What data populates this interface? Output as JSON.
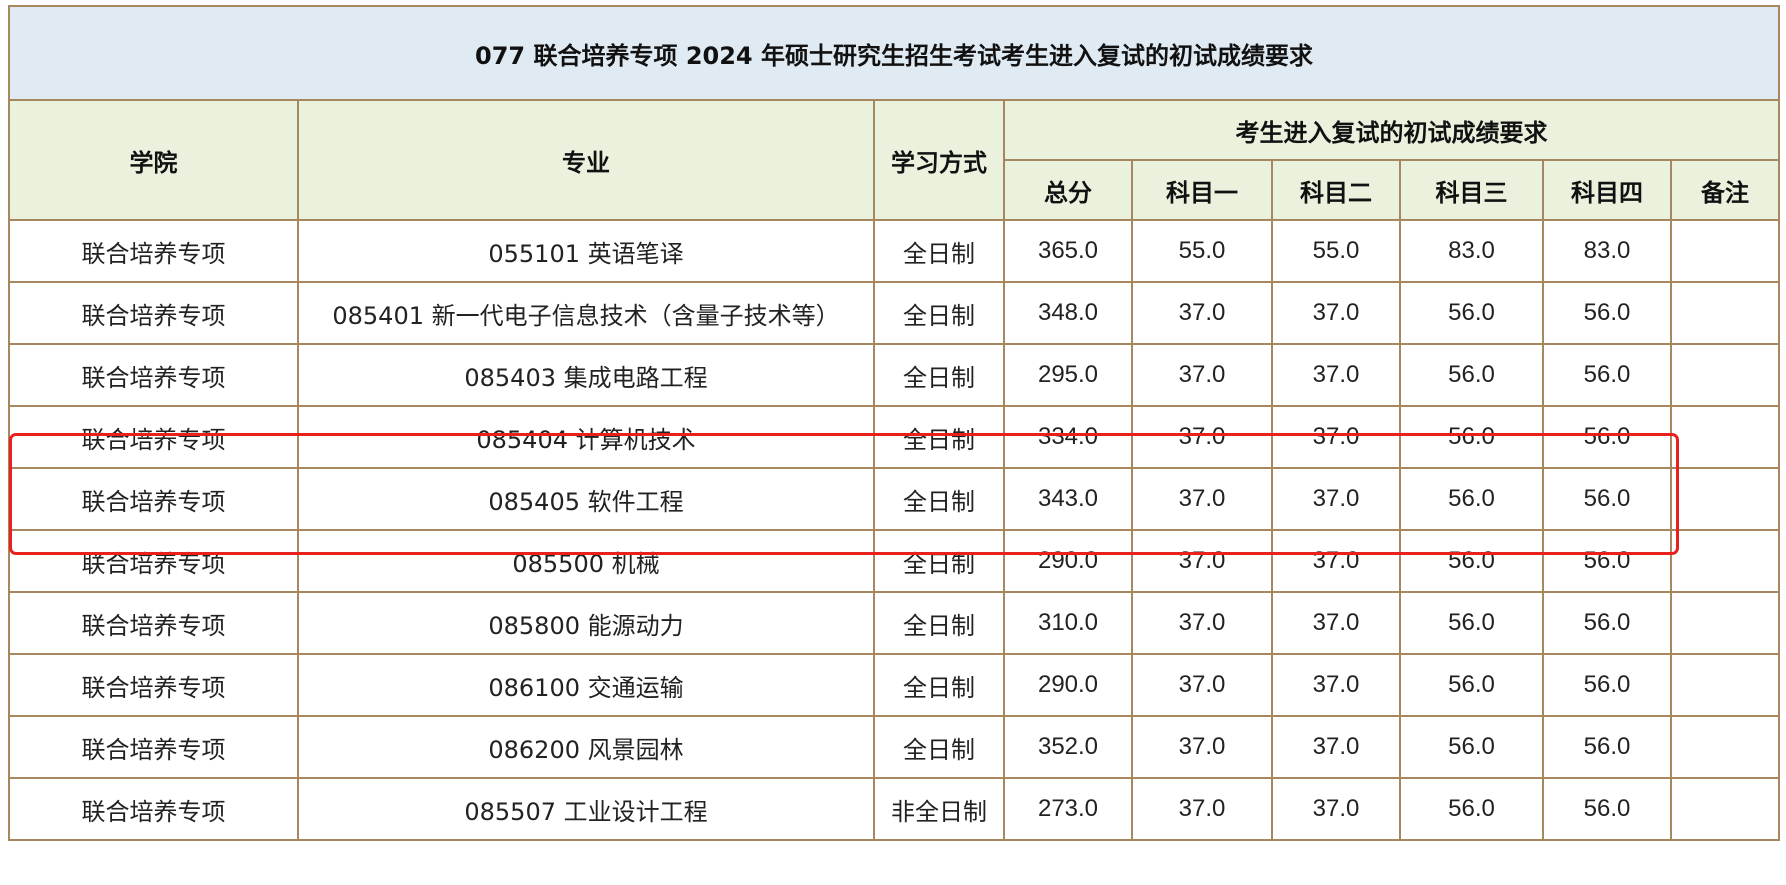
{
  "title": "077 联合培养专项 2024 年硕士研究生招生考试考生进入复试的初试成绩要求",
  "headers": {
    "college": "学院",
    "major": "专业",
    "study_mode": "学习方式",
    "requirements_group": "考生进入复试的初试成绩要求",
    "total": "总分",
    "subject1": "科目一",
    "subject2": "科目二",
    "subject3": "科目三",
    "subject4": "科目四",
    "remark": "备注"
  },
  "rows": [
    {
      "college": "联合培养专项",
      "major": "055101 英语笔译",
      "mode": "全日制",
      "total": "365.0",
      "s1": "55.0",
      "s2": "55.0",
      "s3": "83.0",
      "s4": "83.0",
      "remark": ""
    },
    {
      "college": "联合培养专项",
      "major": "085401 新一代电子信息技术（含量子技术等）",
      "mode": "全日制",
      "total": "348.0",
      "s1": "37.0",
      "s2": "37.0",
      "s3": "56.0",
      "s4": "56.0",
      "remark": ""
    },
    {
      "college": "联合培养专项",
      "major": "085403 集成电路工程",
      "mode": "全日制",
      "total": "295.0",
      "s1": "37.0",
      "s2": "37.0",
      "s3": "56.0",
      "s4": "56.0",
      "remark": ""
    },
    {
      "college": "联合培养专项",
      "major": "085404 计算机技术",
      "mode": "全日制",
      "total": "334.0",
      "s1": "37.0",
      "s2": "37.0",
      "s3": "56.0",
      "s4": "56.0",
      "remark": ""
    },
    {
      "college": "联合培养专项",
      "major": "085405 软件工程",
      "mode": "全日制",
      "total": "343.0",
      "s1": "37.0",
      "s2": "37.0",
      "s3": "56.0",
      "s4": "56.0",
      "remark": ""
    },
    {
      "college": "联合培养专项",
      "major": "085500 机械",
      "mode": "全日制",
      "total": "290.0",
      "s1": "37.0",
      "s2": "37.0",
      "s3": "56.0",
      "s4": "56.0",
      "remark": ""
    },
    {
      "college": "联合培养专项",
      "major": "085800 能源动力",
      "mode": "全日制",
      "total": "310.0",
      "s1": "37.0",
      "s2": "37.0",
      "s3": "56.0",
      "s4": "56.0",
      "remark": ""
    },
    {
      "college": "联合培养专项",
      "major": "086100 交通运输",
      "mode": "全日制",
      "total": "290.0",
      "s1": "37.0",
      "s2": "37.0",
      "s3": "56.0",
      "s4": "56.0",
      "remark": ""
    },
    {
      "college": "联合培养专项",
      "major": "086200 风景园林",
      "mode": "全日制",
      "total": "352.0",
      "s1": "37.0",
      "s2": "37.0",
      "s3": "56.0",
      "s4": "56.0",
      "remark": ""
    },
    {
      "college": "联合培养专项",
      "major": "085507 工业设计工程",
      "mode": "非全日制",
      "total": "273.0",
      "s1": "37.0",
      "s2": "37.0",
      "s3": "56.0",
      "s4": "56.0",
      "remark": ""
    }
  ],
  "colors": {
    "title_background": "#dfeaf2",
    "header_background": "#eaf2de",
    "border": "#a6875e",
    "part_time_text": "#e8201e",
    "highlight_box": "#e8201e"
  }
}
